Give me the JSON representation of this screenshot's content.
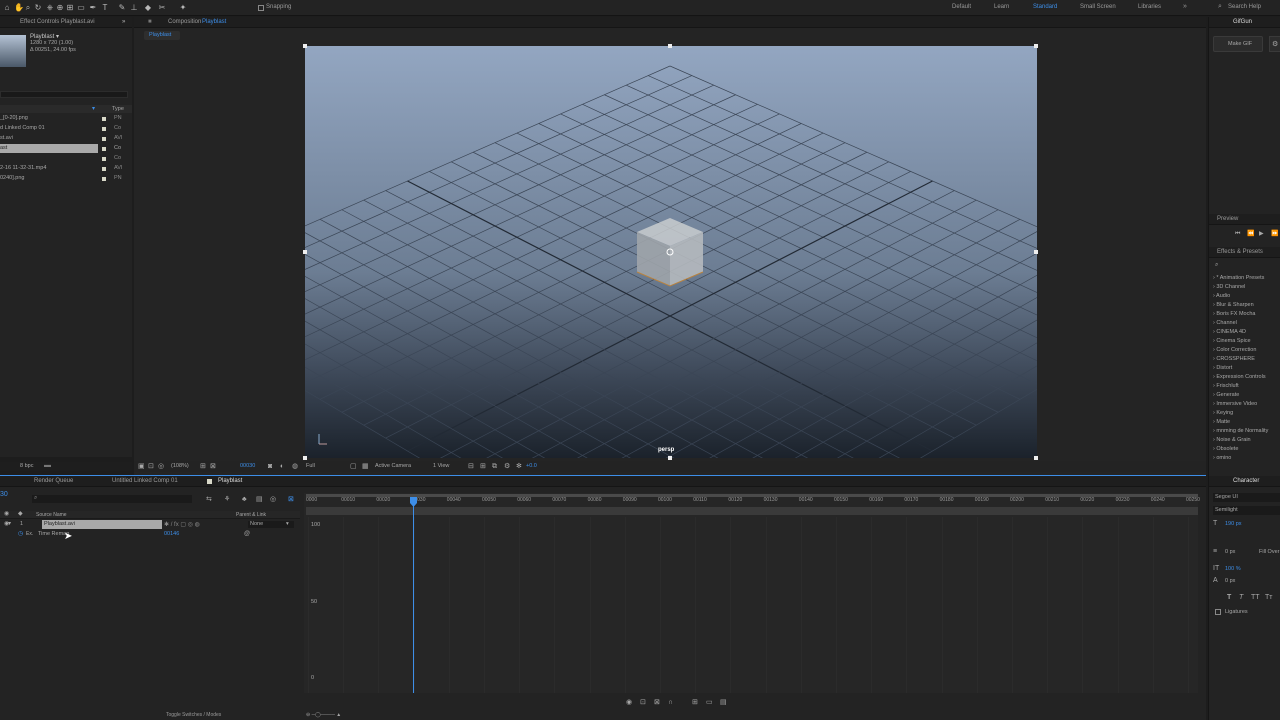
{
  "toolbar": {
    "snapping_label": "Snapping",
    "workspaces": [
      "Default",
      "Learn",
      "Standard",
      "Small Screen",
      "Libraries"
    ],
    "active_workspace": "Standard",
    "search_label": "Search Help"
  },
  "effect_controls": {
    "tab_label": "Effect Controls Playblast.avi",
    "item_name": "Playblast ▾",
    "item_info_1": "1280 x 720 (1.00)",
    "item_info_2": "Δ 00251, 24.00 fps"
  },
  "project": {
    "type_header": "Type",
    "items": [
      {
        "name": "_[0-20].png",
        "type": "PN"
      },
      {
        "name": "d Linked Comp 01",
        "type": "Co"
      },
      {
        "name": "st.avi",
        "type": "AVI"
      },
      {
        "name": "ast",
        "type": "Co"
      },
      {
        "name": "",
        "type": "Co"
      },
      {
        "name": "2-16 11-32-31.mp4",
        "type": "AVI"
      },
      {
        "name": "0240].png",
        "type": "PN"
      }
    ],
    "bpc": "8 bpc"
  },
  "composition": {
    "tab_label": "Composition",
    "tab_name": "Playblast",
    "sub_tab": "Playblast",
    "viewport_label": "persp",
    "colors": {
      "sky_top": "#8fa3bf",
      "sky_bottom": "#2c3745",
      "grid": "#3f4a58"
    }
  },
  "viewer_controls": {
    "zoom": "(108%)",
    "timecode": "00030",
    "resolution": "Full",
    "camera": "Active Camera",
    "views": "1 View",
    "exposure": "+0.0"
  },
  "timeline": {
    "tabs": [
      "Render Queue",
      "Untitled Linked Comp 01",
      "Playblast"
    ],
    "current_time": "30",
    "col_source_name": "Source Name",
    "col_parent": "Parent & Link",
    "layer_index": "1",
    "layer_name": "Playblast.avi",
    "layer_parent": "None",
    "property_name": "Time Remap",
    "property_value": "00146",
    "ruler_ticks": [
      "0000",
      "00010",
      "00020",
      "00030",
      "00040",
      "00050",
      "00060",
      "00070",
      "00080",
      "00090",
      "00100",
      "00110",
      "00120",
      "00130",
      "00140",
      "00150",
      "00160",
      "00170",
      "00180",
      "00190",
      "00200",
      "00210",
      "00220",
      "00230",
      "00240",
      "00250"
    ],
    "graph_labels": [
      "100",
      "50",
      "0"
    ],
    "toggle_label": "Toggle Switches / Modes",
    "colors": {
      "accent": "#3d8ee8"
    }
  },
  "right_panels": {
    "gifgun_tab": "GifGun",
    "make_gif": "Make GIF",
    "preview_tab": "Preview",
    "effects_tab": "Effects & Presets",
    "effects": [
      "* Animation Presets",
      "3D Channel",
      "Audio",
      "Blur & Sharpen",
      "Boris FX Mocha",
      "Channel",
      "CINEMA 4D",
      "Cinema Spice",
      "Color Correction",
      "CROSSPHERE",
      "Distort",
      "Expression Controls",
      "Frischluft",
      "Generate",
      "Immersive Video",
      "Keying",
      "Matte",
      "mnming de Normality",
      "Noise & Grain",
      "Obsolete",
      "omino"
    ],
    "character_tab": "Character",
    "font": "Segoe UI",
    "font_style": "Semilight",
    "font_size": "190 px",
    "tracking_val": "0 px",
    "fill_label": "Fill Over",
    "vscale": "100 %",
    "baseline": "0 px",
    "ligatures": "Ligatures"
  }
}
